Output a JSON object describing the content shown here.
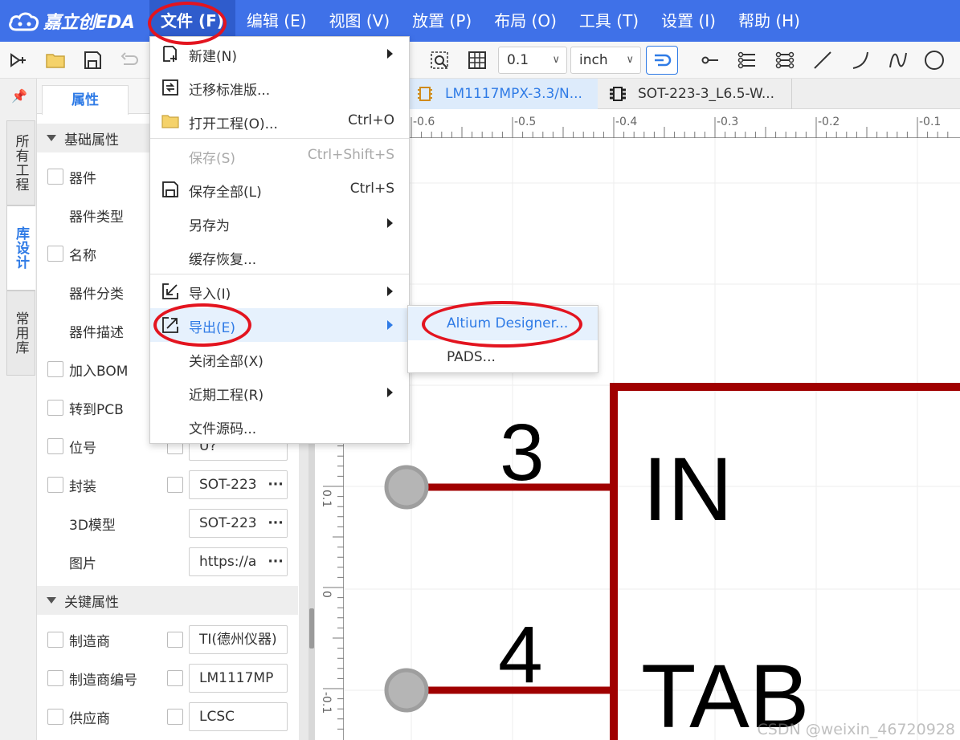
{
  "app": {
    "logo_text": "嘉立创EDA",
    "brand_color": "#3f71e8",
    "accent_color": "#2f7be6",
    "annotation_color": "#e3141f"
  },
  "menubar": {
    "items": [
      {
        "label": "文件 (F)",
        "active": true
      },
      {
        "label": "编辑 (E)"
      },
      {
        "label": "视图 (V)"
      },
      {
        "label": "放置 (P)"
      },
      {
        "label": "布局 (O)"
      },
      {
        "label": "工具 (T)"
      },
      {
        "label": "设置 (I)"
      },
      {
        "label": "帮助 (H)"
      }
    ]
  },
  "toolbar": {
    "grid_value": "0.1",
    "unit_value": "inch",
    "icons": [
      "pin-tool-icon",
      "open-folder-icon",
      "save-icon",
      "undo-icon",
      "zoom-fit-icon",
      "grid-icon",
      "wire-route-icon",
      "pin-icon",
      "pin-list-icon",
      "pin-matrix-icon",
      "line-icon",
      "arc-icon",
      "bezier-icon",
      "circle-icon"
    ]
  },
  "vtabs": [
    {
      "label": "所有工程"
    },
    {
      "label": "库设计",
      "active": true
    },
    {
      "label": "常用库"
    }
  ],
  "panel": {
    "tab_label": "属性",
    "section_basic": "基础属性",
    "section_key": "关键属性",
    "rows": [
      {
        "label": "器件"
      },
      {
        "label": "器件类型"
      },
      {
        "label": "名称"
      },
      {
        "label": "器件分类"
      },
      {
        "label": "器件描述"
      },
      {
        "label": "加入BOM"
      },
      {
        "label": "转到PCB"
      },
      {
        "label": "位号",
        "value": "U?"
      },
      {
        "label": "封装",
        "value": "SOT-223"
      },
      {
        "label": "3D模型",
        "value": "SOT-223"
      },
      {
        "label": "图片",
        "value": "https://a"
      }
    ],
    "key_rows": [
      {
        "label": "制造商",
        "value": "TI(德州仪器)"
      },
      {
        "label": "制造商编号",
        "value": "LM1117MP"
      },
      {
        "label": "供应商",
        "value": "LCSC"
      }
    ],
    "more": "···"
  },
  "doc_tabs": [
    {
      "label": "LM1117MPX-3.3/N...",
      "active": true
    },
    {
      "label": "SOT-223-3_L6.5-W..."
    }
  ],
  "ruler": {
    "h_labels": [
      "-0.6",
      "-0.5",
      "-0.4",
      "-0.3",
      "-0.2",
      "-0.1"
    ],
    "v_labels": [
      "0.1",
      "0",
      "-0.1"
    ]
  },
  "schematic": {
    "pins": [
      {
        "number": "3",
        "name": "IN"
      },
      {
        "number": "4",
        "name": "TAB"
      }
    ],
    "body_color": "#a00000",
    "pin_end_color": "#9e9e9e"
  },
  "file_menu": {
    "items": [
      {
        "label": "新建(N)",
        "icon": "new-file-icon",
        "submenu": true
      },
      {
        "label": "迁移标准版...",
        "icon": "migrate-icon"
      },
      {
        "label": "打开工程(O)...",
        "icon": "open-project-icon",
        "shortcut": "Ctrl+O"
      },
      {
        "label": "保存(S)",
        "shortcut": "Ctrl+Shift+S",
        "disabled": true
      },
      {
        "label": "保存全部(L)",
        "icon": "save-all-icon",
        "shortcut": "Ctrl+S"
      },
      {
        "label": "另存为",
        "submenu": true
      },
      {
        "label": "缓存恢复..."
      },
      {
        "label": "导入(I)",
        "icon": "import-icon",
        "submenu": true
      },
      {
        "label": "导出(E)",
        "icon": "export-icon",
        "submenu": true,
        "hover": true
      },
      {
        "label": "关闭全部(X)"
      },
      {
        "label": "近期工程(R)",
        "submenu": true
      },
      {
        "label": "文件源码..."
      }
    ]
  },
  "export_submenu": {
    "items": [
      {
        "label": "Altium Designer...",
        "hover": true
      },
      {
        "label": "PADS..."
      }
    ]
  },
  "watermark": "CSDN @weixin_46720928"
}
